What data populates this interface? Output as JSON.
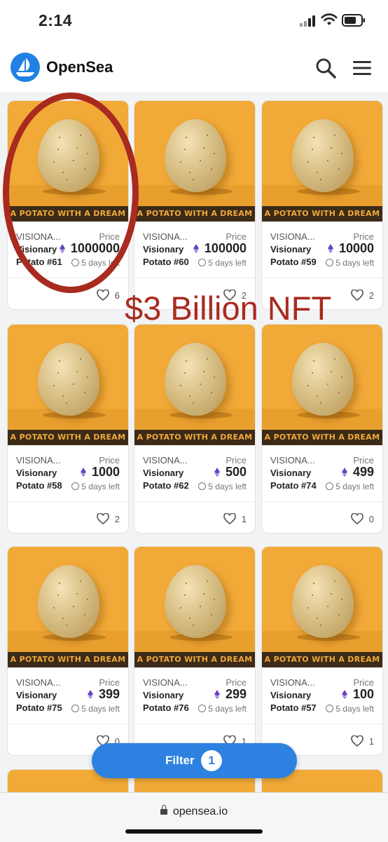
{
  "status_bar": {
    "time": "2:14"
  },
  "header": {
    "brand": "OpenSea"
  },
  "card_common": {
    "collection": "VISIONA...",
    "price_label": "Price",
    "name_line1": "Visionary",
    "time_left": "5 days left",
    "image_banner": "A POTATO WITH A DREAM"
  },
  "cards": [
    {
      "name_line2": "Potato #61",
      "price": "1000000",
      "likes": "6"
    },
    {
      "name_line2": "Potato #60",
      "price": "100000",
      "likes": "2"
    },
    {
      "name_line2": "Potato #59",
      "price": "10000",
      "likes": "2"
    },
    {
      "name_line2": "Potato #58",
      "price": "1000",
      "likes": "2"
    },
    {
      "name_line2": "Potato #62",
      "price": "500",
      "likes": "1"
    },
    {
      "name_line2": "Potato #74",
      "price": "499",
      "likes": "0"
    },
    {
      "name_line2": "Potato #75",
      "price": "399",
      "likes": "0"
    },
    {
      "name_line2": "Potato #76",
      "price": "299",
      "likes": "1"
    },
    {
      "name_line2": "Potato #57",
      "price": "100",
      "likes": "1"
    }
  ],
  "annotation": {
    "text": "$3 Billion NFT",
    "color": "#a92a1f"
  },
  "filter": {
    "label": "Filter",
    "count": "1"
  },
  "browser": {
    "url": "opensea.io"
  },
  "colors": {
    "accent": "#2081e2",
    "eth": "#6a3fc6",
    "card_bg": "#f1a938"
  }
}
